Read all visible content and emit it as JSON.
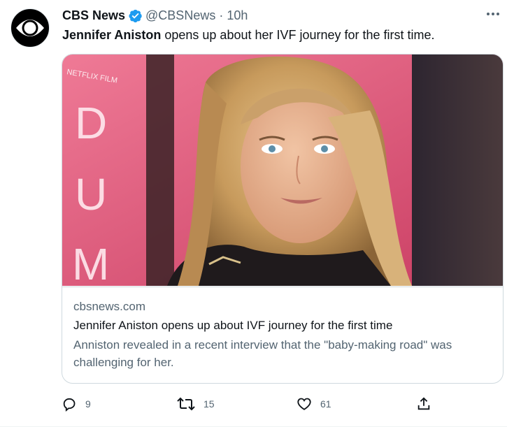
{
  "account": {
    "display_name": "CBS News",
    "handle": "@CBSNews",
    "separator": "·",
    "timestamp": "10h",
    "verified": true
  },
  "tweet": {
    "text_bold": "Jennifer Aniston",
    "text_rest": " opens up about her IVF journey for the first time."
  },
  "card": {
    "image_backdrop_text": "NETFLIX FILM",
    "image_backdrop_letters": [
      "D",
      "U",
      "M"
    ],
    "image_backdrop_big": "DUM",
    "domain": "cbsnews.com",
    "title": "Jennifer Aniston opens up about IVF journey for the first time",
    "description": "Anniston revealed in a recent interview that the \"baby-making road\" was challenging for her."
  },
  "actions": {
    "replies": "9",
    "retweets": "15",
    "likes": "61"
  },
  "colors": {
    "verified_blue": "#1d9bf0",
    "secondary_text": "#536471",
    "backdrop_pink": "#e0567a"
  }
}
